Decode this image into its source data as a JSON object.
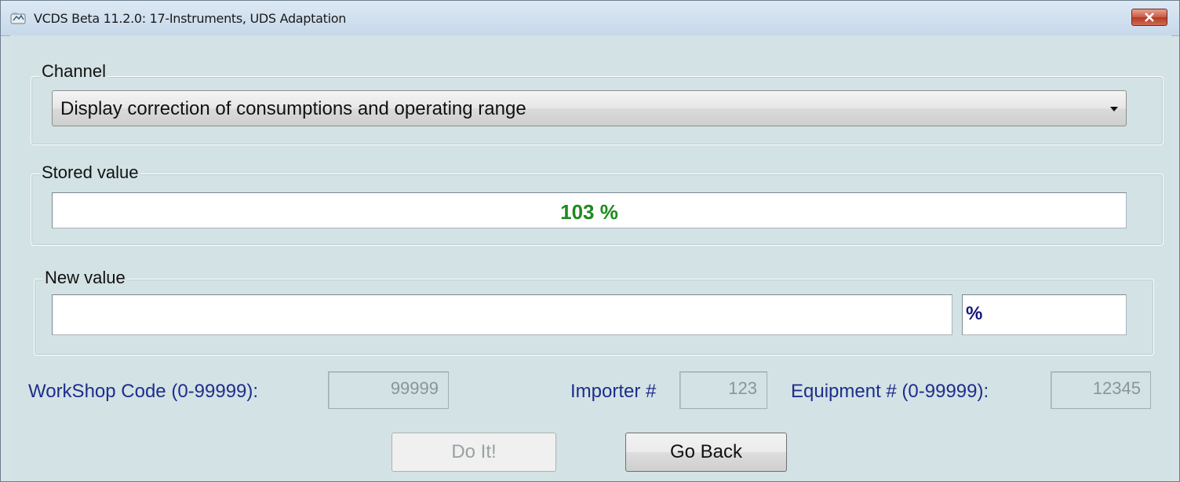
{
  "window": {
    "title": "VCDS Beta 11.2.0: 17-Instruments,  UDS Adaptation",
    "close_icon": "close-icon"
  },
  "channel": {
    "label": "Channel",
    "selected": "Display correction of consumptions and operating range"
  },
  "stored": {
    "label": "Stored value",
    "value": "103 %",
    "color": "#1e8a1e"
  },
  "new_value": {
    "label": "New value",
    "value": "",
    "unit": "%"
  },
  "footer": {
    "workshop_label": "WorkShop Code (0-99999):",
    "workshop_value": "99999",
    "importer_label": "Importer #",
    "importer_value": "123",
    "equipment_label": "Equipment # (0-99999):",
    "equipment_value": "12345"
  },
  "buttons": {
    "do_it": "Do It!",
    "go_back": "Go Back"
  }
}
